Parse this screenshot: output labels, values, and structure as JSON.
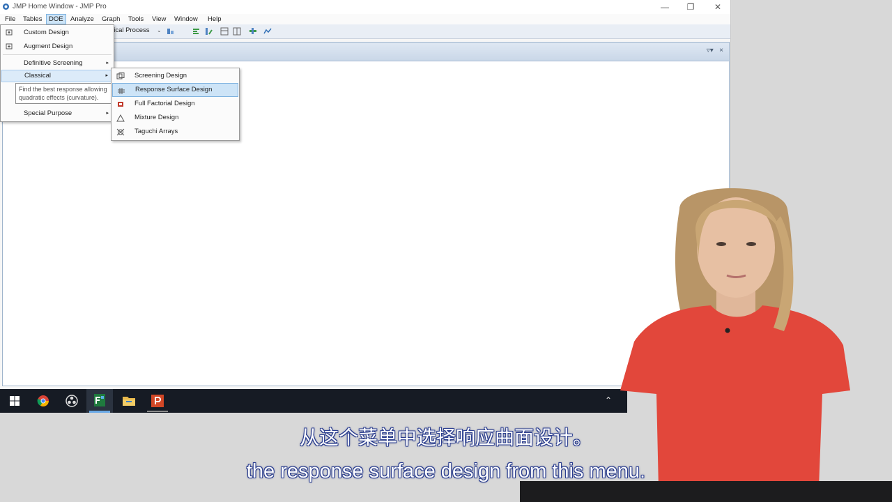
{
  "window": {
    "title": "JMP Home Window - JMP Pro",
    "controls": {
      "minimize": "—",
      "restore": "❐",
      "close": "✕"
    }
  },
  "menubar": {
    "items": [
      "File",
      "Tables",
      "DOE",
      "Analyze",
      "Graph",
      "Tools",
      "View",
      "Window",
      "Help"
    ],
    "active": "DOE"
  },
  "toolbar": {
    "visible_text": "nical Process"
  },
  "doe_menu": {
    "items": [
      {
        "label": "Custom Design",
        "icon": "custom-design-icon",
        "submenu": false
      },
      {
        "label": "Augment Design",
        "icon": "augment-design-icon",
        "submenu": false
      },
      {
        "label": "Definitive Screening",
        "icon": "",
        "submenu": true
      },
      {
        "label": "Classical",
        "icon": "",
        "submenu": true,
        "highlighted": true
      },
      {
        "label": "Special Purpose",
        "icon": "",
        "submenu": true
      }
    ],
    "submenu_arrow": "▸"
  },
  "tooltip": {
    "line1": "Find the best response allowing",
    "line2": "quadratic effects (curvature)."
  },
  "classical_submenu": {
    "items": [
      {
        "label": "Screening Design",
        "icon": "screening-design-icon"
      },
      {
        "label": "Response Surface Design",
        "icon": "response-surface-icon",
        "highlighted": true
      },
      {
        "label": "Full Factorial Design",
        "icon": "full-factorial-icon"
      },
      {
        "label": "Mixture Design",
        "icon": "mixture-design-icon"
      },
      {
        "label": "Taguchi Arrays",
        "icon": "taguchi-arrays-icon"
      }
    ]
  },
  "taskbar": {
    "apps": [
      "windows-start-icon",
      "chrome-icon",
      "obs-icon",
      "jmp-icon",
      "file-explorer-icon",
      "powerpoint-icon"
    ],
    "active_app": "jmp-icon",
    "tray_chevron": "⌃"
  },
  "subtitles": {
    "zh": "从这个菜单中选择响应曲面设计。",
    "en": "the response surface design from this menu."
  },
  "colors": {
    "menu_highlight": "#cde4f7",
    "taskbar": "#161b24",
    "shirt": "#e2473b",
    "subtitle_outline": "#2a3d8f"
  }
}
